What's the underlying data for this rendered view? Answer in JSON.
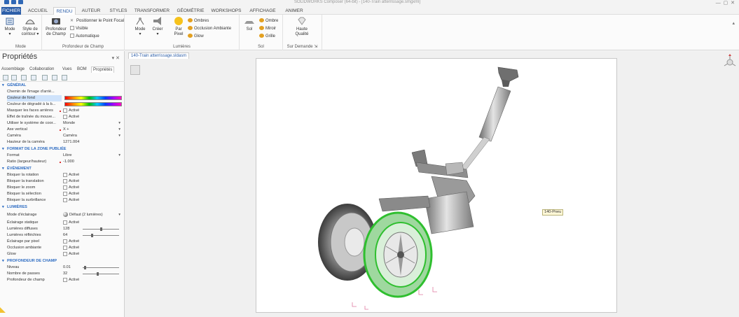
{
  "app": {
    "title": "SOLIDWORKS Composer (64-bit) - [140-Train atterrissage.smgxml]"
  },
  "ribbon_tabs": [
    "FICHIER",
    "ACCUEIL",
    "RENDU",
    "AUTEUR",
    "STYLES",
    "TRANSFORMER",
    "GÉOMÉTRIE",
    "WORKSHOPS",
    "AFFICHAGE",
    "ANIMER"
  ],
  "active_tab": "RENDU",
  "ribbon": {
    "mode_group": {
      "label": "Mode",
      "mode_btn": "Mode",
      "style_btn_1": "Style de",
      "style_btn_2": "contour"
    },
    "dof_group": {
      "label": "Profondeur de Champ",
      "btn_1": "Profondeur",
      "btn_2": "de Champ",
      "position_focal": "Positionner le Point Focal",
      "visible": "Visible",
      "automatique": "Automatique"
    },
    "lights_group": {
      "label": "Lumières",
      "mode": "Mode",
      "creer": "Créer",
      "par_pixel_1": "Par",
      "par_pixel_2": "Pixel",
      "ombres": "Ombres",
      "occlusion": "Occlusion Ambiante",
      "glow": "Glow"
    },
    "sol_group": {
      "label": "Sol",
      "sol": "Sol",
      "ombre": "Ombre",
      "miroir": "Miroir",
      "grille": "Grille"
    },
    "demand_group": {
      "label": "Sur Demande",
      "haute_1": "Haute",
      "haute_2": "Qualité"
    }
  },
  "panel": {
    "title": "Propriétés",
    "tabs": [
      "Assemblage",
      "Collaboration",
      "Vues",
      "BOM",
      "Propriétés"
    ],
    "active_tab": "Propriétés",
    "sections": {
      "general": "GÉNÉRAL",
      "format": "FORMAT DE LA ZONE PUBLIÉE",
      "evenement": "ÉVÉNEMENT",
      "lumieres": "LUMIÈRES",
      "profondeur": "PROFONDEUR DE CHAMP"
    },
    "rows": {
      "chemin": {
        "label": "Chemin de l'image d'arriè...",
        "value": ""
      },
      "couleur_fond": {
        "label": "Couleur de fond",
        "value": ""
      },
      "couleur_degrade": {
        "label": "Couleur de dégradé à la b...",
        "value": ""
      },
      "masquer": {
        "label": "Masquer les faces arrières",
        "value": "Activé"
      },
      "effet": {
        "label": "Effet de traînée du mouve...",
        "value": "Activé"
      },
      "utiliser": {
        "label": "Utiliser le système de coor...",
        "value": "Monde"
      },
      "axe": {
        "label": "Axe vertical",
        "value": "X +"
      },
      "camera": {
        "label": "Caméra",
        "value": "Caméra"
      },
      "hauteur": {
        "label": "Hauteur de la caméra",
        "value": "1271.004"
      },
      "format": {
        "label": "Format",
        "value": "Libre"
      },
      "ratio": {
        "label": "Ratio (largeur/hauteur)",
        "value": "-1.000"
      },
      "bloq_rot": {
        "label": "Bloquer la rotation",
        "value": "Activé"
      },
      "bloq_trans": {
        "label": "Bloquer la translation",
        "value": "Activé"
      },
      "bloq_zoom": {
        "label": "Bloquer le zoom",
        "value": "Activé"
      },
      "bloq_sel": {
        "label": "Bloquer la sélection",
        "value": "Activé"
      },
      "bloq_surb": {
        "label": "Bloquer la surbrillance",
        "value": "Activé"
      },
      "mode_ecl": {
        "label": "Mode d'éclairage",
        "value": "Défaut (2 lumières)"
      },
      "ecl_stat": {
        "label": "Éclairage statique",
        "value": "Activé"
      },
      "lum_diff": {
        "label": "Lumières diffuses",
        "value": "128"
      },
      "lum_refl": {
        "label": "Lumières réfléchies",
        "value": "64"
      },
      "ecl_pix": {
        "label": "Éclairage par pixel",
        "value": "Activé"
      },
      "occ_amb": {
        "label": "Occlusion ambiante",
        "value": "Activé"
      },
      "glow": {
        "label": "Glow",
        "value": "Activé"
      },
      "niveau": {
        "label": "Niveau",
        "value": "0.01"
      },
      "nb_passes": {
        "label": "Nombre de passes",
        "value": "32"
      },
      "prof_champ": {
        "label": "Profondeur de champ",
        "value": "Activé"
      }
    },
    "sliders": {
      "lum_diff": 0.5,
      "lum_refl": 0.25,
      "niveau": 0.05,
      "nb_passes": 0.4
    }
  },
  "document": {
    "tab": "140-Train atterrissage.sldasm",
    "callout": "140-Pneu"
  },
  "colors": {
    "accent": "#2c5ea8",
    "section": "#2c6bc2",
    "selection_green": "#3ad13a",
    "model_grey": "#9a9a9a"
  }
}
